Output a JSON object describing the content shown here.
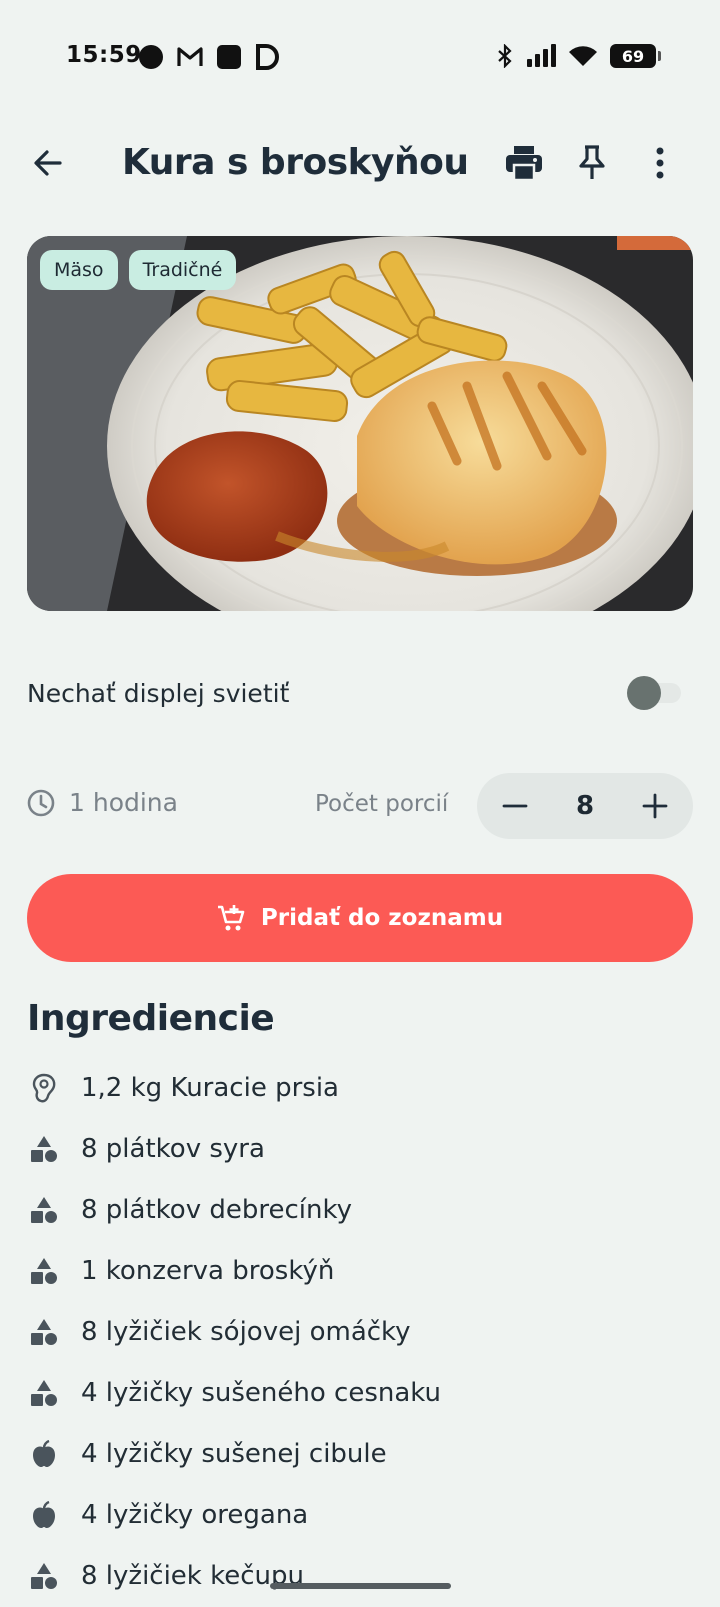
{
  "status_bar": {
    "time": "15:59",
    "battery": "69"
  },
  "header": {
    "title": "Kura s broskyňou",
    "back_icon": "arrow-left-icon",
    "actions": [
      "print-icon",
      "pin-icon",
      "more-vert-icon"
    ]
  },
  "hero": {
    "tags": [
      "Mäso",
      "Tradičné"
    ]
  },
  "keep_screen_on": {
    "label": "Nechať displej svietiť",
    "enabled": false
  },
  "meta": {
    "time_icon": "clock-icon",
    "time": "1 hodina",
    "servings_label": "Počet porcií",
    "servings": "8"
  },
  "add_to_list": {
    "icon": "cart-plus-icon",
    "label": "Pridať do zoznamu"
  },
  "ingredients": {
    "title": "Ingrediencie",
    "items": [
      {
        "icon": "meat-icon",
        "text": "1,2 kg Kuracie prsia"
      },
      {
        "icon": "shapes-icon",
        "text": "8 plátkov syra"
      },
      {
        "icon": "shapes-icon",
        "text": "8 plátkov debrecínky"
      },
      {
        "icon": "shapes-icon",
        "text": "1 konzerva broskýň"
      },
      {
        "icon": "shapes-icon",
        "text": "8 lyžičiek sójovej omáčky"
      },
      {
        "icon": "shapes-icon",
        "text": "4 lyžičky sušeného cesnaku"
      },
      {
        "icon": "apple-icon",
        "text": "4 lyžičky sušenej cibule"
      },
      {
        "icon": "apple-icon",
        "text": "4 lyžičky oregana"
      },
      {
        "icon": "shapes-icon",
        "text": "8 lyžičiek kečupu"
      }
    ]
  },
  "colors": {
    "background": "#eff3f1",
    "accent": "#fc5a55",
    "chip": "#c9ede2",
    "title": "#1f2d3a"
  }
}
